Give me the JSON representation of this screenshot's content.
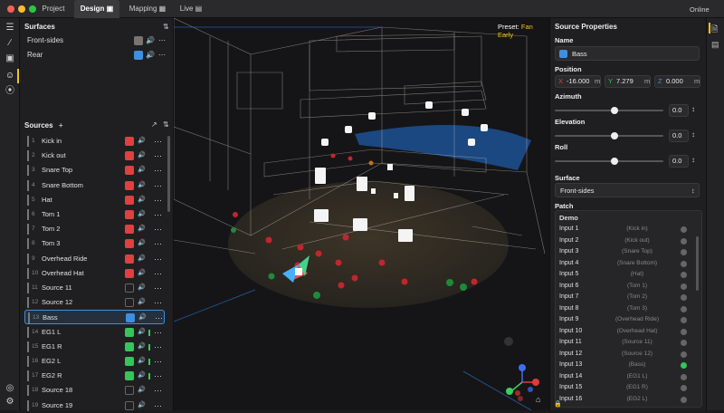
{
  "window": {
    "tabs": [
      {
        "label": "Project"
      },
      {
        "label": "Design"
      },
      {
        "label": "Mapping"
      },
      {
        "label": "Live"
      }
    ],
    "status": "Online"
  },
  "left": {
    "surfaces_title": "Surfaces",
    "surfaces": [
      {
        "name": "Front-sides",
        "color": "#7a7470"
      },
      {
        "name": "Rear",
        "color": "#3e8fe0"
      }
    ],
    "sources_title": "Sources",
    "sources": [
      {
        "num": "1",
        "name": "Kick in",
        "color": "#e04040"
      },
      {
        "num": "2",
        "name": "Kick out",
        "color": "#e04040"
      },
      {
        "num": "3",
        "name": "Snare Top",
        "color": "#e04040"
      },
      {
        "num": "4",
        "name": "Snare Bottom",
        "color": "#e04040"
      },
      {
        "num": "5",
        "name": "Hat",
        "color": "#e04040"
      },
      {
        "num": "6",
        "name": "Tom 1",
        "color": "#e04040"
      },
      {
        "num": "7",
        "name": "Tom 2",
        "color": "#e04040"
      },
      {
        "num": "8",
        "name": "Tom 3",
        "color": "#e04040"
      },
      {
        "num": "9",
        "name": "Overhead Ride",
        "color": "#e04040"
      },
      {
        "num": "10",
        "name": "Overhead Hat",
        "color": "#e04040"
      },
      {
        "num": "11",
        "name": "Source 11",
        "color": "#1f1f21"
      },
      {
        "num": "12",
        "name": "Source 12",
        "color": "#1f1f21"
      },
      {
        "num": "13",
        "name": "Bass",
        "color": "#3e8fe0"
      },
      {
        "num": "14",
        "name": "EG1 L",
        "color": "#35c55a"
      },
      {
        "num": "15",
        "name": "EG1 R",
        "color": "#35c55a"
      },
      {
        "num": "16",
        "name": "EG2 L",
        "color": "#35c55a"
      },
      {
        "num": "17",
        "name": "EG2 R",
        "color": "#35c55a"
      },
      {
        "num": "18",
        "name": "Source 18",
        "color": "#1f1f21"
      },
      {
        "num": "19",
        "name": "Source 19",
        "color": "#1f1f21"
      }
    ]
  },
  "viewport": {
    "preset_label": "Preset:",
    "preset_value": "Fan Early"
  },
  "right": {
    "title": "Source Properties",
    "name_label": "Name",
    "name_value": "Bass",
    "name_color": "#3e8fe0",
    "position_label": "Position",
    "x": {
      "axis": "X",
      "value": "-16.000",
      "unit": "m"
    },
    "y": {
      "axis": "Y",
      "value": "7.279",
      "unit": "m"
    },
    "z": {
      "axis": "Z",
      "value": "0.000",
      "unit": "m"
    },
    "azimuth": {
      "label": "Azimuth",
      "value": "0.0",
      "level": 0.55
    },
    "elevation": {
      "label": "Elevation",
      "value": "0.0",
      "level": 0.55
    },
    "roll": {
      "label": "Roll",
      "value": "0.0",
      "level": 0.55
    },
    "surface_label": "Surface",
    "surface_value": "Front-sides",
    "patch_label": "Patch",
    "patch_group": "Demo",
    "patch": [
      {
        "input": "Input 1",
        "source": "(Kick in)"
      },
      {
        "input": "Input 2",
        "source": "(Kick out)"
      },
      {
        "input": "Input 3",
        "source": "(Snare Top)"
      },
      {
        "input": "Input 4",
        "source": "(Snare Bottom)"
      },
      {
        "input": "Input 5",
        "source": "(Hat)"
      },
      {
        "input": "Input 6",
        "source": "(Tom 1)"
      },
      {
        "input": "Input 7",
        "source": "(Tom 2)"
      },
      {
        "input": "Input 8",
        "source": "(Tom 3)"
      },
      {
        "input": "Input 9",
        "source": "(Overhead Ride)"
      },
      {
        "input": "Input 10",
        "source": "(Overhead Hat)"
      },
      {
        "input": "Input 11",
        "source": "(Source 11)"
      },
      {
        "input": "Input 12",
        "source": "(Source 12)"
      },
      {
        "input": "Input 13",
        "source": "(Bass)",
        "active": true
      },
      {
        "input": "Input 14",
        "source": "(EG1 L)"
      },
      {
        "input": "Input 15",
        "source": "(EG1 R)"
      },
      {
        "input": "Input 16",
        "source": "(EG2 L)"
      }
    ]
  }
}
